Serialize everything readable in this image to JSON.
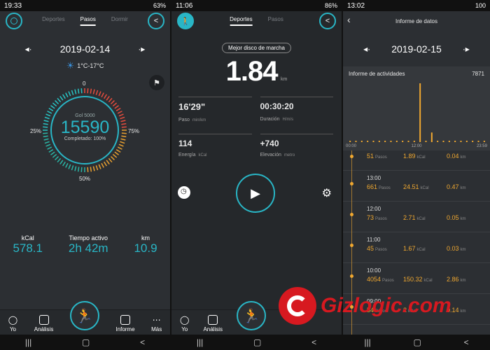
{
  "screen1": {
    "status": {
      "time": "19:33",
      "battery": "63%"
    },
    "tabs": [
      "Deportes",
      "Pasos",
      "Dormir"
    ],
    "date": "2019-02-14",
    "weather": "1°C-17°C",
    "gauge": {
      "goal": "Gol 5000",
      "steps": "15590",
      "completed": "Completado: 100%",
      "pct_0": "0",
      "pct_25": "25%",
      "pct_50": "50%",
      "pct_75": "75%",
      "progress": 1.0
    },
    "stats": [
      {
        "label": "kCal",
        "value": "578.1"
      },
      {
        "label": "Tiempo activo",
        "value": "2h 42m"
      },
      {
        "label": "km",
        "value": "10.9"
      }
    ],
    "nav": [
      "Yo",
      "Análisis",
      "",
      "Informe",
      "Más"
    ]
  },
  "screen2": {
    "status": {
      "time": "11:06",
      "battery": "86%"
    },
    "tabs": [
      "Deportes",
      "Pasos"
    ],
    "best_label": "Mejor disco de marcha",
    "distance": "1.84",
    "distance_unit": "km",
    "cells": [
      {
        "value": "16'29\"",
        "label": "Paso",
        "unit": "min/km"
      },
      {
        "value": "00:30:20",
        "label": "Duración",
        "unit": "H/m/s"
      },
      {
        "value": "114",
        "label": "Energía",
        "unit": "kCal"
      },
      {
        "value": "+740",
        "label": "Elevación",
        "unit": "metro"
      }
    ],
    "nav": [
      "Yo",
      "Análisis"
    ]
  },
  "screen3": {
    "status": {
      "time": "13:02",
      "battery": "100"
    },
    "title": "Informe de datos",
    "date": "2019-02-15",
    "card_title": "Informe de actividades",
    "card_total": "7871",
    "x_labels": [
      "00:00",
      "12:00",
      "23:59"
    ],
    "chart_data": {
      "type": "bar",
      "values": [
        0,
        0,
        0,
        0,
        0,
        0,
        0,
        0,
        0,
        0,
        45,
        54,
        4054,
        73,
        661,
        0,
        51,
        0,
        0,
        0,
        0,
        0,
        0,
        0
      ],
      "xlabel": "",
      "ylabel": ""
    },
    "rows": [
      {
        "time": "",
        "steps": "51",
        "km": "1.89",
        "kcal": "0.04"
      },
      {
        "time": "13:00",
        "steps": "661",
        "km": "24.51",
        "kcal": "0.47"
      },
      {
        "time": "12:00",
        "steps": "73",
        "km": "2.71",
        "kcal": "0.05"
      },
      {
        "time": "11:00",
        "steps": "45",
        "km": "1.67",
        "kcal": "0.03"
      },
      {
        "time": "10:00",
        "steps": "4054",
        "km": "150.32",
        "kcal": "2.86"
      },
      {
        "time": "09:00",
        "steps": "54",
        "km": "2",
        "kcal": "0.14"
      }
    ],
    "units": {
      "steps": "Pasos",
      "kcal": "kCal",
      "km": "km"
    },
    "watermark": "Gizlogic.com"
  },
  "colors": {
    "accent": "#29b6c6",
    "bar": "#f0a830"
  }
}
